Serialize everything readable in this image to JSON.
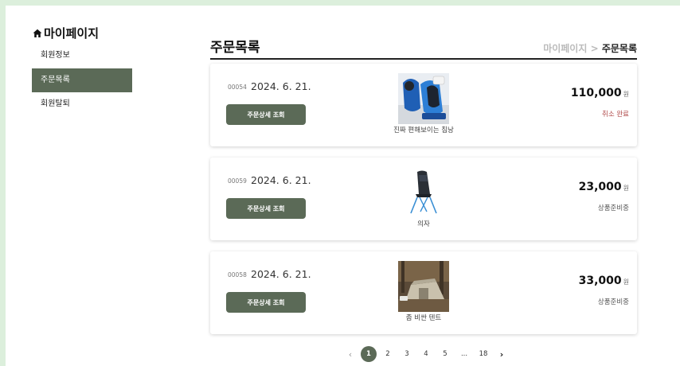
{
  "sidebar": {
    "title": "마이페이지",
    "items": [
      {
        "label": "회원정보",
        "active": false
      },
      {
        "label": "주문목록",
        "active": true
      },
      {
        "label": "회원탈퇴",
        "active": false
      }
    ]
  },
  "header": {
    "title": "주문목록",
    "breadcrumb": {
      "parent": "마이페이지",
      "separator": ">",
      "current": "주문목록"
    }
  },
  "orders": [
    {
      "order_no": "00054",
      "date": "2024. 6. 21.",
      "button_label": "주문상세 조회",
      "product_name": "진짜 편해보이는 침낭",
      "price": "110,000",
      "currency": "원",
      "status": "취소 완료"
    },
    {
      "order_no": "00059",
      "date": "2024. 6. 21.",
      "button_label": "주문상세 조회",
      "product_name": "의자",
      "price": "23,000",
      "currency": "원",
      "status": "상품준비중"
    },
    {
      "order_no": "00058",
      "date": "2024. 6. 21.",
      "button_label": "주문상세 조회",
      "product_name": "좀 비싼 텐트",
      "price": "33,000",
      "currency": "원",
      "status": "상품준비중"
    }
  ],
  "pagination": {
    "prev": "‹",
    "pages": [
      "1",
      "2",
      "3",
      "4",
      "5"
    ],
    "ellipsis": "...",
    "last": "18",
    "next": "›",
    "current": "1"
  },
  "colors": {
    "accent": "#5b6a57",
    "cancel": "#b04a4a",
    "frame": "#dcefdc"
  }
}
